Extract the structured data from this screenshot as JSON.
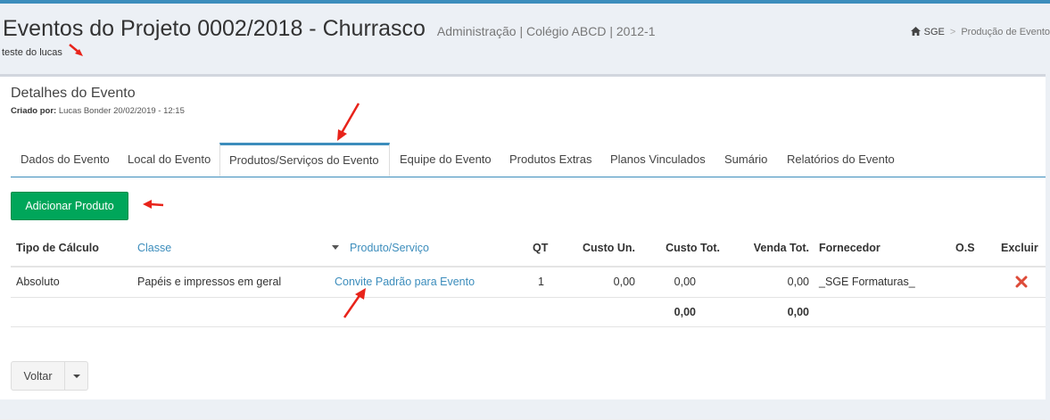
{
  "header": {
    "title": "Eventos do Projeto 0002/2018 - Churrasco",
    "subtitle": "Administração | Colégio ABCD | 2012-1",
    "caption": "teste do lucas"
  },
  "breadcrumb": {
    "home": "SGE",
    "current": "Produção de Evento"
  },
  "details": {
    "title": "Detalhes do Evento",
    "created_label": "Criado por:",
    "created_value": "Lucas Bonder 20/02/2019 - 12:15"
  },
  "tabs": [
    {
      "label": "Dados do Evento"
    },
    {
      "label": "Local do Evento"
    },
    {
      "label": "Produtos/Serviços do Evento"
    },
    {
      "label": "Equipe do Evento"
    },
    {
      "label": "Produtos Extras"
    },
    {
      "label": "Planos Vinculados"
    },
    {
      "label": "Sumário"
    },
    {
      "label": "Relatórios do Evento"
    }
  ],
  "add_product_label": "Adicionar Produto",
  "table": {
    "headers": {
      "tipo": "Tipo de Cálculo",
      "classe": "Classe",
      "produto": "Produto/Serviço",
      "qt": "QT",
      "custo_un": "Custo Un.",
      "custo_tot": "Custo Tot.",
      "venda_tot": "Venda Tot.",
      "fornecedor": "Fornecedor",
      "os": "O.S",
      "excluir": "Excluir"
    },
    "rows": [
      {
        "tipo": "Absoluto",
        "classe": "Papéis e impressos em geral",
        "produto": "Convite Padrão para Evento",
        "qt": "1",
        "custo_un": "0,00",
        "custo_tot": "0,00",
        "venda_tot": "0,00",
        "fornecedor": "_SGE Formaturas_",
        "os": ""
      }
    ],
    "totals": {
      "custo_tot": "0,00",
      "venda_tot": "0,00"
    }
  },
  "back_label": "Voltar",
  "colors": {
    "accent": "#3c8dbc",
    "success": "#00a65a",
    "danger": "#dd4b39",
    "annotation": "#e8231a"
  }
}
